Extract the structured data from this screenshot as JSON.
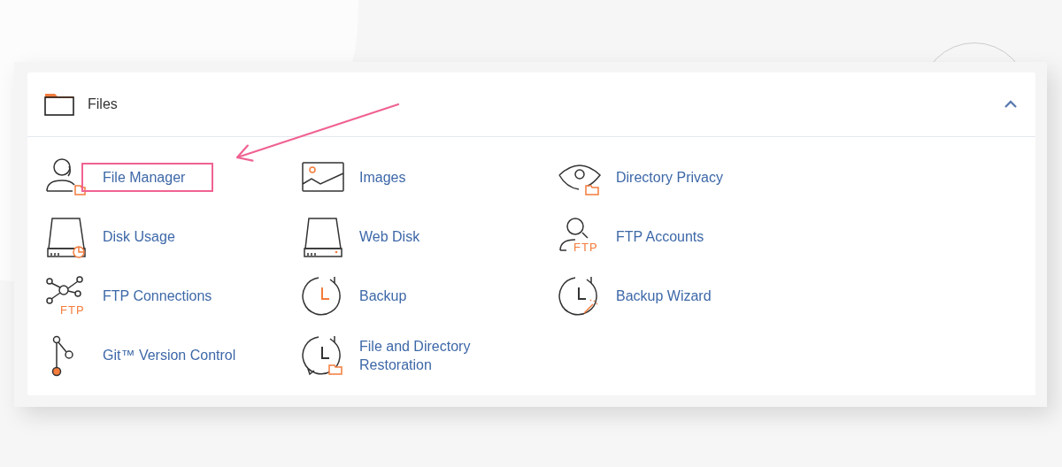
{
  "panel": {
    "title": "Files",
    "expanded": true
  },
  "items": [
    {
      "label": "File Manager",
      "kind": "userfolder",
      "highlighted": true
    },
    {
      "label": "Images",
      "kind": "image",
      "highlighted": false
    },
    {
      "label": "Directory Privacy",
      "kind": "eyefolder",
      "highlighted": false
    },
    {
      "label": "Disk Usage",
      "kind": "diskchart",
      "highlighted": false
    },
    {
      "label": "Web Disk",
      "kind": "disk",
      "highlighted": false
    },
    {
      "label": "FTP Accounts",
      "kind": "userftp",
      "badge": "FTP",
      "highlighted": false
    },
    {
      "label": "FTP Connections",
      "kind": "network",
      "badge": "FTP",
      "highlighted": false
    },
    {
      "label": "Backup",
      "kind": "clock",
      "highlighted": false
    },
    {
      "label": "Backup Wizard",
      "kind": "clockwand",
      "highlighted": false
    },
    {
      "label": "Git™ Version Control",
      "kind": "git",
      "highlighted": false
    },
    {
      "label": "File and Directory Restoration",
      "kind": "clockrestore",
      "highlighted": false
    }
  ]
}
